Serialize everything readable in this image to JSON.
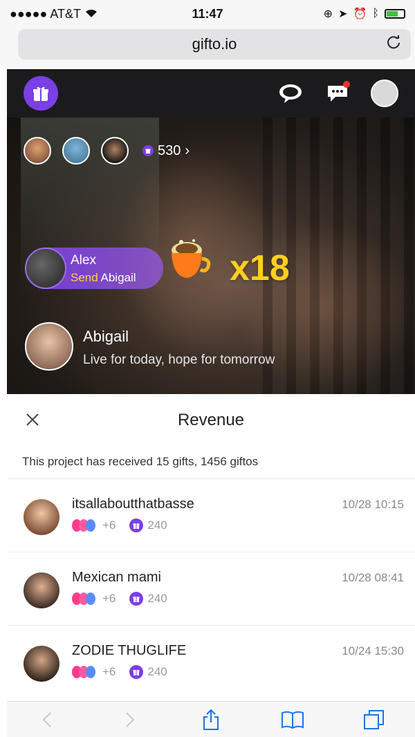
{
  "status_bar": {
    "carrier": "●●●●● AT&T",
    "time": "11:47"
  },
  "browser": {
    "url": "gifto.io"
  },
  "stream": {
    "viewer_count": "530",
    "gift_event": {
      "sender_name": "Alex",
      "send_word": "Send",
      "recipient": "Abigail",
      "multiplier": "x18"
    },
    "host": {
      "name": "Abigail",
      "tagline": "Live for today,  hope for tomorrow"
    }
  },
  "revenue_sheet": {
    "title": "Revenue",
    "summary": "This project has received 15 gifts, 1456 giftos",
    "entries": [
      {
        "name": "itsallaboutthatbasse",
        "time": "10/28 10:15",
        "extra": "+6",
        "amount": "240"
      },
      {
        "name": "Mexican mami",
        "time": "10/28 08:41",
        "extra": "+6",
        "amount": "240"
      },
      {
        "name": "ZODIE THUGLIFE",
        "time": "10/24 15:30",
        "extra": "+6",
        "amount": "240"
      }
    ]
  },
  "colors": {
    "brand_purple": "#7b3fe4",
    "gift_count_yellow": "#ffcf1f",
    "notification_red": "#ff2d2d"
  },
  "icons": {
    "header": [
      "gift-icon",
      "chat-bubble-icon",
      "message-icon",
      "profile-icon"
    ],
    "toolbar": [
      "back-icon",
      "forward-icon",
      "share-icon",
      "bookmarks-icon",
      "tabs-icon"
    ]
  }
}
